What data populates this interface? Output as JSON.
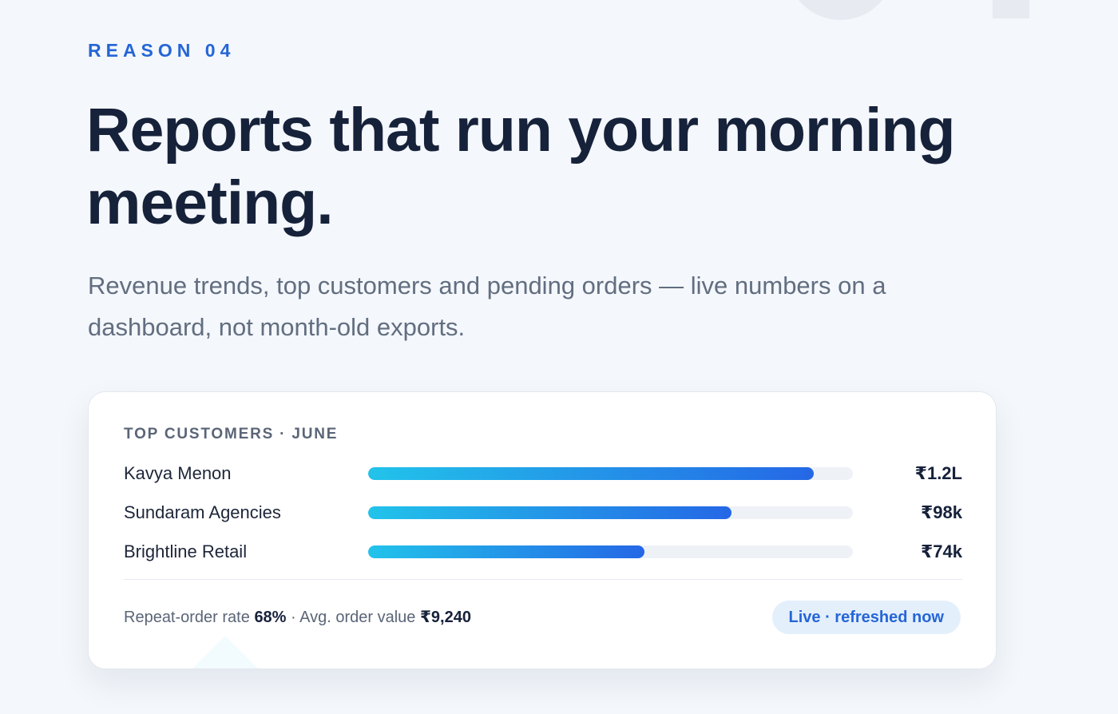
{
  "section": {
    "eyebrow": "REASON 04",
    "headline": "Reports that run your morning meeting.",
    "lede": "Revenue trends, top customers and pending orders — live numbers on a dashboard, not month-old exports."
  },
  "card": {
    "title": "TOP CUSTOMERS · JUNE",
    "rows": [
      {
        "name": "Kavya Menon",
        "value": "₹1.2L",
        "fill_fraction": 0.92
      },
      {
        "name": "Sundaram Agencies",
        "value": "₹98k",
        "fill_fraction": 0.75
      },
      {
        "name": "Brightline Retail",
        "value": "₹74k",
        "fill_fraction": 0.57
      }
    ],
    "stats": {
      "repeat_label": "Repeat-order rate",
      "repeat_value": "68%",
      "separator": "·",
      "aov_label": "Avg. order value",
      "aov_value": "₹9,240"
    },
    "live_label": "Live · refreshed now"
  },
  "colors": {
    "accent": "#2566d6",
    "bar_start": "#22c3ea",
    "bar_end": "#2567e6",
    "heading": "#16213a",
    "muted": "#626e80",
    "pill_bg": "#e4effc"
  }
}
